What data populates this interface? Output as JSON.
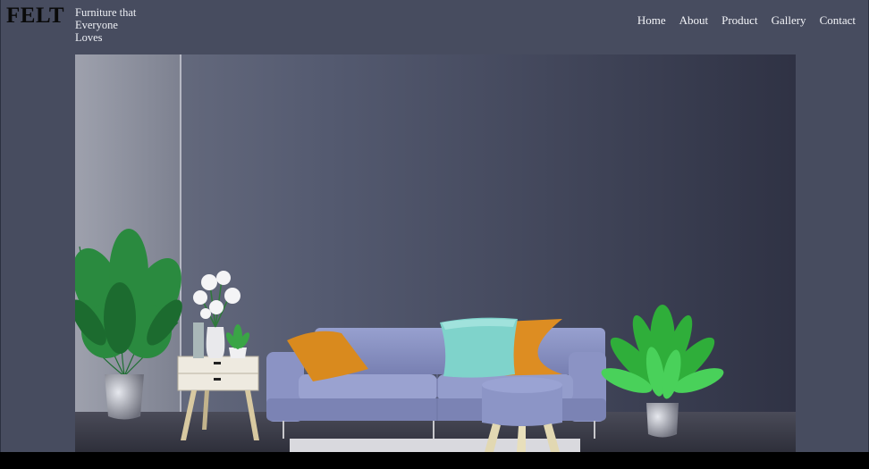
{
  "brand": {
    "logo": "FELT",
    "tagline": "Furniture that Everyone Loves"
  },
  "nav": {
    "items": [
      "Home",
      "About",
      "Product",
      "Gallery",
      "Contact"
    ]
  },
  "hero": {
    "image_icon": "living-room-photo",
    "colors": {
      "wall": "#4a4f63",
      "floor": "#3b3d4b",
      "sofa": "#8c95c6",
      "pillow_orange": "#d98a1e",
      "pillow_teal": "#7fd3cb",
      "plant_green": "#2fae3a"
    }
  }
}
